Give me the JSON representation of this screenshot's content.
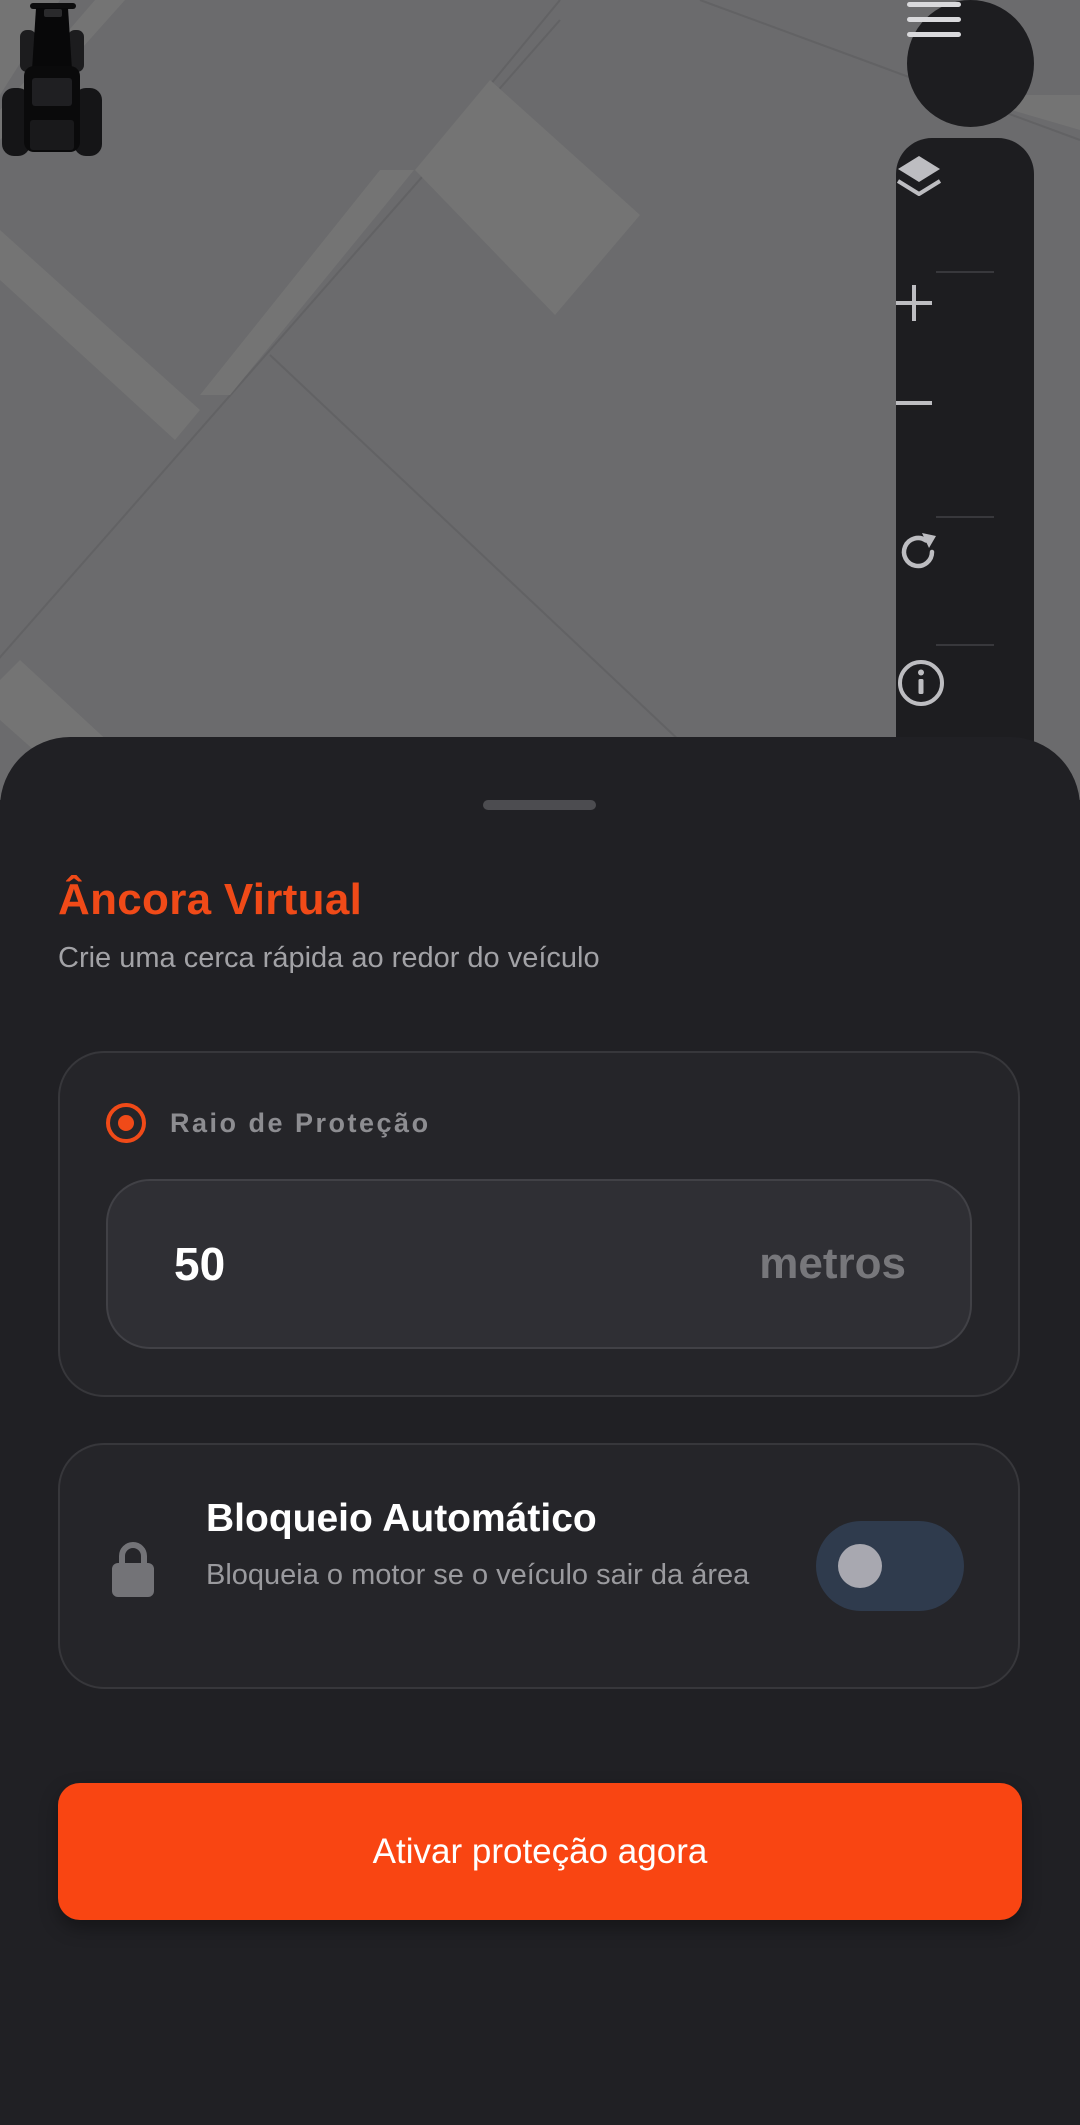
{
  "map": {
    "menu_icon": "hamburger-menu-icon",
    "tools": [
      {
        "icon": "layers-icon"
      },
      {
        "icon": "plus-icon"
      },
      {
        "icon": "minus-icon"
      },
      {
        "icon": "refresh-icon"
      },
      {
        "icon": "info-icon"
      }
    ],
    "vehicle_icon": "tractor-icon",
    "colors": {
      "background": "#6b6b6d",
      "road": "#747474"
    }
  },
  "sheet": {
    "title": "Âncora Virtual",
    "subtitle": "Crie uma cerca rápida ao redor do veículo",
    "radius": {
      "label": "Raio de Proteção",
      "value": "50",
      "unit": "metros"
    },
    "auto_lock": {
      "icon": "lock-icon",
      "title": "Bloqueio Automático",
      "description": "Bloqueia o motor se o veículo sair da área",
      "enabled": false
    },
    "cta_label": "Ativar proteção agora"
  },
  "colors": {
    "accent": "#f94512",
    "sheet_background": "#202024",
    "card_background": "#252529",
    "toggle_off": "#2f3b4d"
  }
}
